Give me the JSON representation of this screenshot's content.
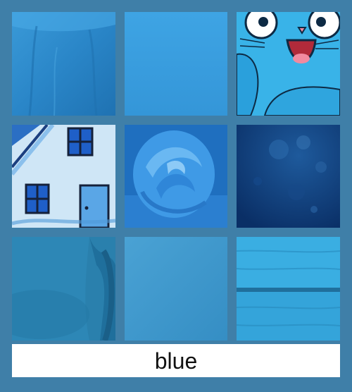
{
  "caption": {
    "text": "blue"
  },
  "colors": {
    "background": "#3f7fa8",
    "caption_box": "#ffffff",
    "caption_text": "#111111"
  },
  "tiles": [
    {
      "name": "tile-blue-tshirt"
    },
    {
      "name": "tile-plain-blue"
    },
    {
      "name": "tile-blue-cartoon-cat"
    },
    {
      "name": "tile-painted-house"
    },
    {
      "name": "tile-blue-fabric-rose"
    },
    {
      "name": "tile-dark-blue-texture"
    },
    {
      "name": "tile-blue-mug-closeup"
    },
    {
      "name": "tile-plain-light-blue"
    },
    {
      "name": "tile-blue-wood-planks"
    }
  ]
}
